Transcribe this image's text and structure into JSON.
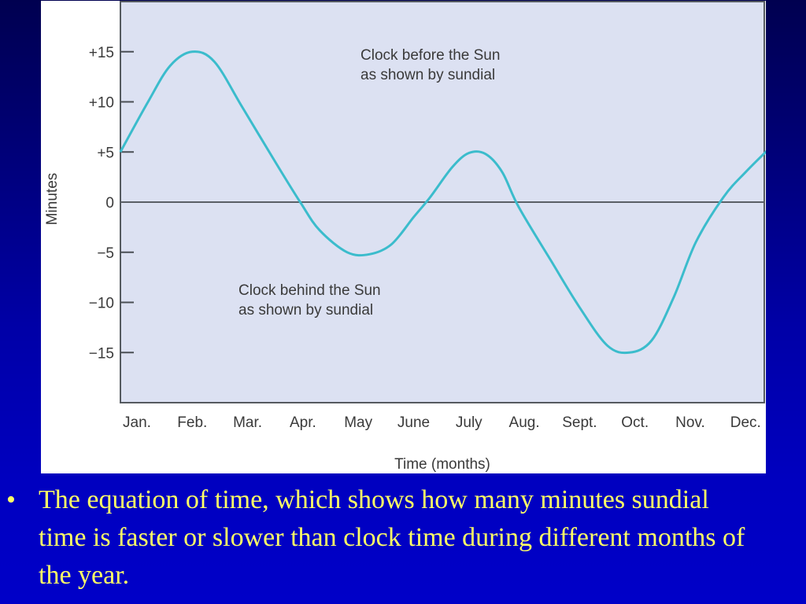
{
  "slide": {
    "background_color": "#0000b0",
    "caption_color": "#ffff66",
    "bullet": "•",
    "caption": "The equation of time, which shows how many minutes sundial time is faster or slower than clock time during different months of the year."
  },
  "chart_data": {
    "type": "line",
    "title": "",
    "xlabel": "Time (months)",
    "ylabel": "Minutes",
    "categories": [
      "Jan.",
      "Feb.",
      "Mar.",
      "Apr.",
      "May",
      "June",
      "July",
      "Aug.",
      "Sept.",
      "Oct.",
      "Nov.",
      "Dec."
    ],
    "yticks": [
      15,
      10,
      5,
      0,
      -5,
      -10,
      -15
    ],
    "ytick_labels": [
      "+15",
      "+10",
      "+5",
      "0",
      "−5",
      "−10",
      "−15"
    ],
    "ylim": [
      -20,
      20
    ],
    "xlim": [
      -0.3,
      11.4
    ],
    "grid": false,
    "zero_line": true,
    "line_color": "#3bbccc",
    "plot_background": "#dce1f2",
    "series": [
      {
        "name": "Equation of time",
        "x": [
          -0.3,
          0.2,
          0.6,
          1.0,
          1.4,
          1.9,
          2.5,
          2.95,
          3.3,
          3.8,
          4.2,
          4.6,
          5.0,
          5.3,
          5.7,
          6.0,
          6.3,
          6.6,
          6.9,
          7.5,
          8.0,
          8.5,
          8.9,
          9.3,
          9.7,
          10.1,
          10.6,
          11.0,
          11.4
        ],
        "values": [
          5.0,
          10.0,
          13.6,
          15.0,
          14.0,
          9.5,
          4.0,
          0.0,
          -2.8,
          -5.0,
          -5.2,
          -4.2,
          -1.5,
          0.5,
          3.5,
          4.9,
          4.8,
          3.0,
          -0.5,
          -6.0,
          -10.5,
          -14.3,
          -15.0,
          -13.8,
          -9.5,
          -4.0,
          0.5,
          3.0,
          5.2
        ]
      }
    ],
    "annotations": [
      {
        "text": [
          "Clock before the Sun",
          "as shown by sundial"
        ],
        "position": "top-center"
      },
      {
        "text": [
          "Clock behind the Sun",
          "as shown by sundial"
        ],
        "position": "lower-left-center"
      }
    ]
  }
}
